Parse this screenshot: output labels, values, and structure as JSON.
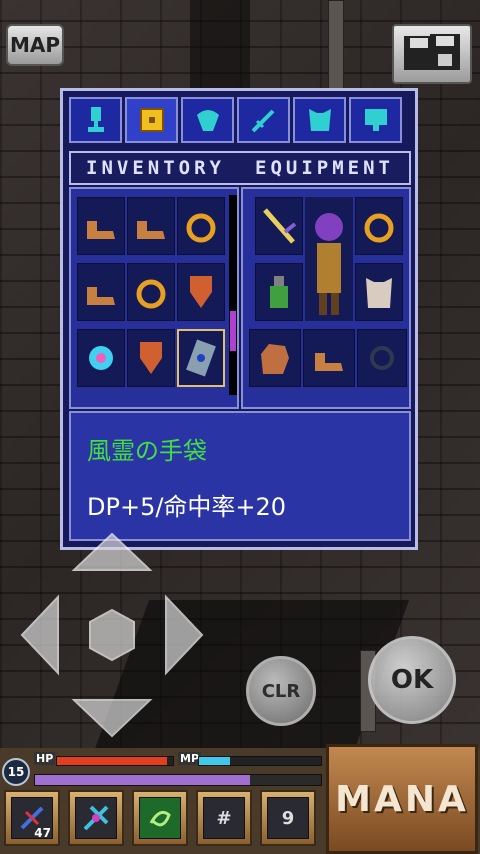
{
  "top": {
    "map_label": "MAP"
  },
  "tabs": [
    "trophy-icon",
    "chest-icon",
    "shell-icon",
    "sword-icon",
    "armor-icon",
    "monitor-icon"
  ],
  "panel": {
    "inventory_title": "INVENTORY",
    "equipment_title": "EQUIPMENT",
    "inventory_items": [
      "boots",
      "boots",
      "ring",
      "boots",
      "ring",
      "shield",
      "crystal",
      "shield",
      "scroll"
    ],
    "equipment_items": [
      "sword",
      "character",
      "ring",
      "potion",
      "armor",
      "glove",
      "boots",
      "amulet"
    ],
    "selected_item": {
      "name": "風霊の手袋",
      "stats": "DP+5/命中率+20"
    }
  },
  "controls": {
    "clr_label": "CLR",
    "ok_label": "OK"
  },
  "hud": {
    "level": "15",
    "hp_label": "HP",
    "mp_label": "MP",
    "hp_fraction": 0.95,
    "mp_fraction": 0.25,
    "exp_fraction": 0.75,
    "quick_slots": [
      {
        "icon": "potion-icon",
        "count": "47"
      },
      {
        "icon": "spell-icon",
        "count": ""
      },
      {
        "icon": "wind-icon",
        "count": ""
      },
      {
        "icon": "hash-icon",
        "text": "#"
      },
      {
        "icon": "nine-icon",
        "text": "9"
      }
    ],
    "mana_label": "MANA"
  },
  "colors": {
    "hp": "#e04020",
    "mp": "#40c8e8",
    "exp": "#a070d0",
    "item_name": "#40e040",
    "panel": "#161a5a"
  }
}
